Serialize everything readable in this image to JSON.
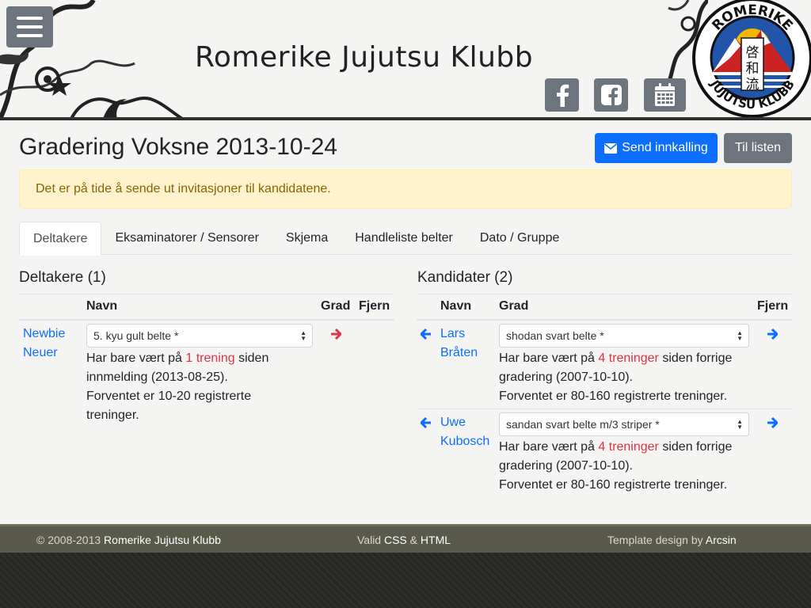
{
  "header": {
    "site_title": "Romerike Jujutsu Klubb",
    "logo_top_text": "ROMERIKE",
    "logo_bottom_text": "JUJUTSU KLUBB",
    "logo_kanji": [
      "啓",
      "和",
      "流"
    ]
  },
  "page": {
    "title": "Gradering Voksne 2013-10-24",
    "send_button": "Send innkalling",
    "list_button": "Til listen",
    "alert": "Det er på tide å sende ut invitasjoner til kandidatene."
  },
  "tabs": [
    "Deltakere",
    "Eksaminatorer / Sensorer",
    "Skjema",
    "Handleliste belter",
    "Dato / Gruppe"
  ],
  "participants": {
    "title": "Deltakere (1)",
    "headers": {
      "name": "Navn",
      "grade": "Grad",
      "remove": "Fjern"
    },
    "rows": [
      {
        "first": "Newbie",
        "last": "Neuer",
        "grade": "5. kyu gult belte *",
        "info_a": "Har bare vært på ",
        "info_hl": "1 trening",
        "info_b": " siden innmelding (2013-08-25).",
        "info_c": "Forventet er 10-20 registrerte treninger."
      }
    ]
  },
  "candidates": {
    "title": "Kandidater (2)",
    "headers": {
      "name": "Navn",
      "grade": "Grad",
      "remove": "Fjern"
    },
    "rows": [
      {
        "first": "Lars",
        "last": "Bråten",
        "grade": "shodan svart belte *",
        "info_a": "Har bare vært på ",
        "info_hl": "4 treninger",
        "info_b": " siden forrige gradering (2007-10-10).",
        "info_c": "Forventet er 80-160 registrerte treninger."
      },
      {
        "first": "Uwe",
        "last": "Kubosch",
        "grade": "sandan svart belte m/3 striper *",
        "info_a": "Har bare vært på ",
        "info_hl": "4 treninger",
        "info_b": " siden forrige gradering (2007-10-10).",
        "info_c": "Forventet er 80-160 registrerte treninger."
      }
    ]
  },
  "footer": {
    "copyright": "© 2008-2013 ",
    "club": "Romerike Jujutsu Klubb",
    "valid": "Valid ",
    "css": "CSS",
    "amp": " & ",
    "html": "HTML",
    "template": "Template design by ",
    "designer": "Arcsin"
  },
  "colors": {
    "primary": "#0d6efd",
    "secondary": "#6c757d",
    "danger": "#dc3545",
    "alert_bg": "#fff3cd",
    "alert_text": "#856404",
    "footer_bg": "#5a5a4a"
  },
  "icons": [
    "menu-icon",
    "facebook-icon",
    "facebook-square-icon",
    "calendar-icon",
    "envelope-icon",
    "arrow-right-icon",
    "arrow-left-icon"
  ]
}
